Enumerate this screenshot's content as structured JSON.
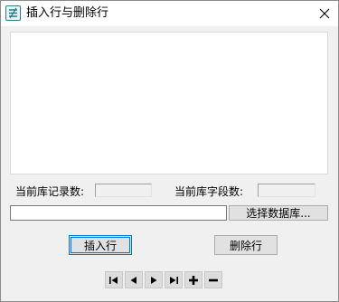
{
  "window": {
    "title": "插入行与删除行",
    "icon": "app-icon",
    "close_icon": "close-icon"
  },
  "records": {
    "label": "当前库记录数:",
    "value": ""
  },
  "fields": {
    "label": "当前库字段数:",
    "value": ""
  },
  "database": {
    "path_value": "",
    "select_button_label": "选择数据库..."
  },
  "actions": {
    "insert_label": "插入行",
    "delete_label": "删除行"
  },
  "navigator": {
    "buttons": [
      {
        "name": "first-record-icon"
      },
      {
        "name": "prior-record-icon"
      },
      {
        "name": "next-record-icon"
      },
      {
        "name": "last-record-icon"
      },
      {
        "name": "insert-record-icon"
      },
      {
        "name": "delete-record-icon"
      }
    ]
  }
}
